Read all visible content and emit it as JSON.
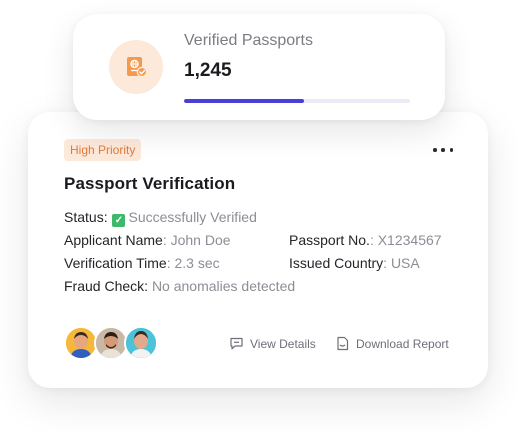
{
  "stat_card": {
    "label": "Verified Passports",
    "value": "1,245",
    "progress_fraction": 0.53,
    "icon": "passport-icon",
    "accent_color": "#4b3fd6"
  },
  "main_card": {
    "badge": "High Priority",
    "badge_color": "#e07b3c",
    "title": "Passport Verification",
    "fields": {
      "status": {
        "label": "Status:",
        "value": "Successfully Verified"
      },
      "applicant_name": {
        "label": "Applicant Name",
        "value": ": John Doe"
      },
      "passport_no": {
        "label": "Passport No.",
        "value": ": X1234567"
      },
      "verification_time": {
        "label": "Verification Time",
        "value": ": 2.3 sec"
      },
      "issued_country": {
        "label": "Issued Country",
        "value": ": USA"
      },
      "fraud_check": {
        "label": "Fraud Check:",
        "value": "No anomalies detected"
      }
    },
    "actions": {
      "view_details": "View Details",
      "download_report": "Download Report"
    },
    "status_check_icon": "check-mark-icon"
  }
}
